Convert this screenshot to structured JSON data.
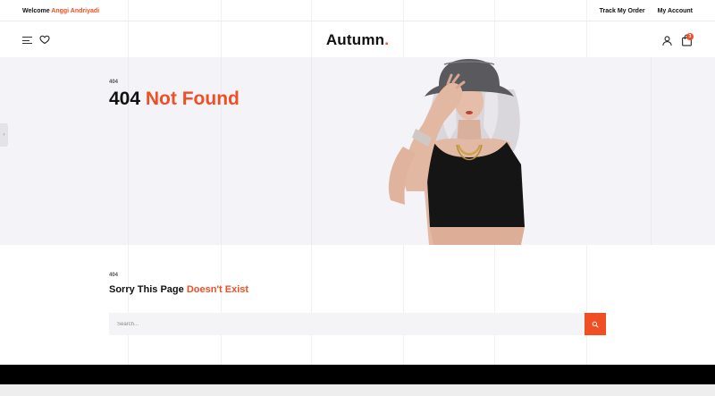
{
  "topbar": {
    "welcome_text": "Welcome",
    "user_name": "Anggi Andriyadi",
    "track_order": "Track My Order",
    "my_account": "My Account"
  },
  "header": {
    "logo": "Autumn",
    "logo_dot": ".",
    "cart_count": "3",
    "icons": [
      "menu-icon",
      "heart-icon",
      "user-icon",
      "bag-icon"
    ]
  },
  "hero": {
    "small_label": "404",
    "title_main": "404",
    "title_accent": "Not Found"
  },
  "error_section": {
    "small_label": "404",
    "title_main": "Sorry This Page",
    "title_accent": "Doesn't Exist"
  },
  "search": {
    "placeholder": "Search..."
  },
  "colors": {
    "accent": "#f04e23",
    "hero_bg": "#f4f3f7",
    "footer": "#000000"
  }
}
